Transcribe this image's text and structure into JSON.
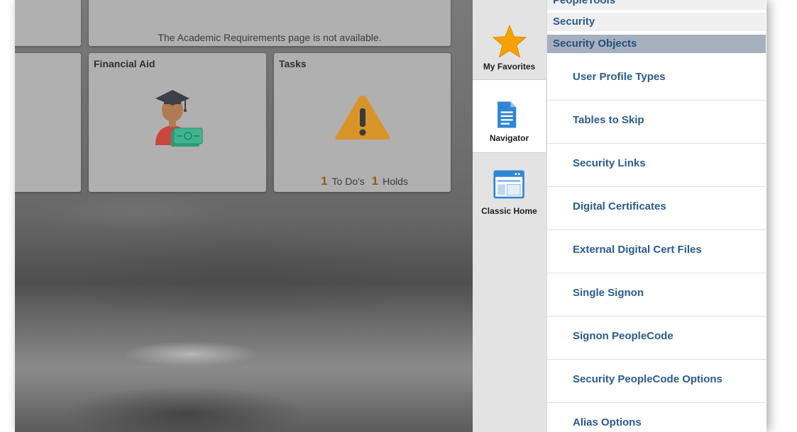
{
  "tiles": {
    "academic_requirements": {
      "message": "The Academic Requirements page is not available."
    },
    "financial_aid": {
      "title": "Financial Aid"
    },
    "tasks": {
      "title": "Tasks",
      "todos_count": "1",
      "todos_label": "To Do's",
      "holds_count": "1",
      "holds_label": "Holds"
    }
  },
  "nav": {
    "favorites_label": "My Favorites",
    "navigator_label": "Navigator",
    "classic_home_label": "Classic Home"
  },
  "menu": {
    "breadcrumbs": [
      "PeopleTools",
      "Security",
      "Security Objects"
    ],
    "items": [
      "User Profile Types",
      "Tables to Skip",
      "Security Links",
      "Digital Certificates",
      "External Digital Cert Files",
      "Single Signon",
      "Signon PeopleCode",
      "Security PeopleCode Options",
      "Alias Options"
    ]
  },
  "colors": {
    "menu_text": "#2a5b8c",
    "selected_crumb_bg": "#a6b0bc",
    "warning_icon": "#d99429",
    "star_icon": "#f6a100",
    "count_accent": "#9a5a12"
  }
}
